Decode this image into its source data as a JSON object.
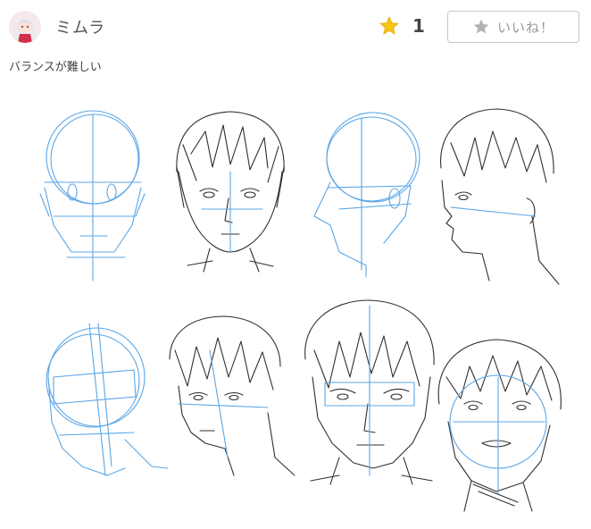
{
  "post": {
    "username": "ミムラ",
    "like_count": "1",
    "like_button_label": "いいね！",
    "caption": "バランスが難しい"
  },
  "icons": {
    "avatar": "user-avatar",
    "star": "star-icon",
    "like_star": "star-outline-icon"
  },
  "colors": {
    "star_gold": "#f5c518",
    "guide_blue": "#5aa6e6",
    "pencil": "#2f2f2f",
    "button_border": "#c8c8c8"
  }
}
